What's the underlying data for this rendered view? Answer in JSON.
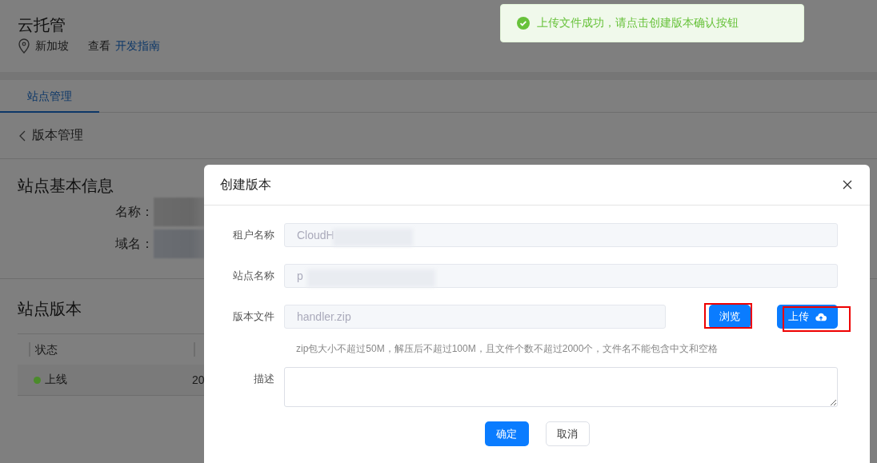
{
  "header": {
    "title": "云托管",
    "region": "新加坡",
    "guide_prefix": "查看",
    "guide_link": "开发指南"
  },
  "tabs": [
    {
      "label": "站点管理",
      "selected": true
    }
  ],
  "breadcrumb": {
    "label": "版本管理"
  },
  "basic_info": {
    "title": "站点基本信息",
    "fields": [
      {
        "label": "名称：",
        "redacted": true
      },
      {
        "label": "域名：",
        "redacted": true
      }
    ]
  },
  "versions": {
    "title": "站点版本",
    "columns": [
      "状态"
    ],
    "rows": [
      {
        "status": "上线",
        "color": "#4b8b2b",
        "column_2": "20"
      }
    ]
  },
  "toast": {
    "kind": "success",
    "message": "上传文件成功，请点击创建版本确认按钮"
  },
  "dialog": {
    "title": "创建版本",
    "fields": [
      {
        "kind": "text",
        "label": "租户名称",
        "value": "CloudH",
        "redacted": true
      },
      {
        "kind": "text",
        "label": "站点名称",
        "value": "p",
        "redacted": true
      },
      {
        "kind": "file",
        "label": "版本文件",
        "value": "handler.zip",
        "buttons": [
          {
            "label": "浏览",
            "kind": "browse",
            "highlighted": true
          },
          {
            "label": "上传",
            "kind": "upload",
            "highlighted": true
          }
        ],
        "hint": "zip包大小不超过50M，解压后不超过100M，且文件个数不超过2000个，文件名不能包含中文和空格"
      },
      {
        "kind": "textarea",
        "label": "描述"
      }
    ],
    "buttons": [
      {
        "label": "确定",
        "kind": "primary"
      },
      {
        "label": "取消",
        "kind": "default"
      }
    ]
  }
}
